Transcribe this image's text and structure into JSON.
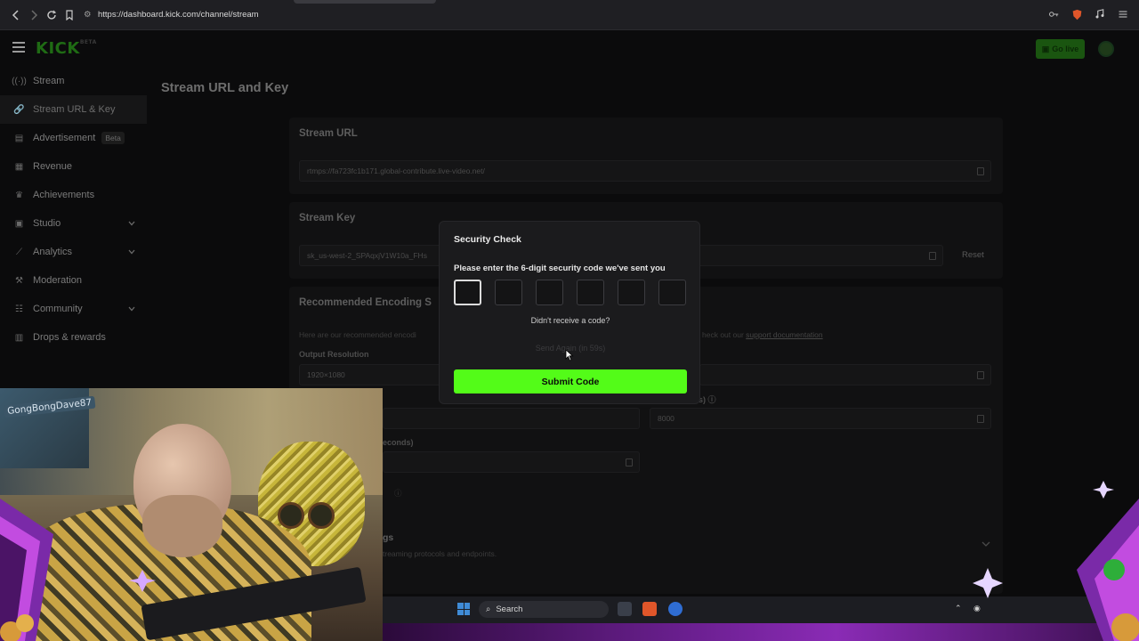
{
  "browser": {
    "url": "https://dashboard.kick.com/channel/stream"
  },
  "header": {
    "logo": "KICK",
    "logo_sup": "BETA",
    "go_live": "Go live"
  },
  "sidebar": {
    "items": [
      {
        "label": "Stream",
        "icon": "broadcast-icon"
      },
      {
        "label": "Stream URL & Key",
        "icon": "link-icon",
        "active": true
      },
      {
        "label": "Advertisement",
        "icon": "ad-icon",
        "badge": "Beta"
      },
      {
        "label": "Revenue",
        "icon": "revenue-icon"
      },
      {
        "label": "Achievements",
        "icon": "trophy-icon"
      },
      {
        "label": "Studio",
        "icon": "studio-icon",
        "expandable": true
      },
      {
        "label": "Analytics",
        "icon": "analytics-icon",
        "expandable": true
      },
      {
        "label": "Moderation",
        "icon": "moderation-icon"
      },
      {
        "label": "Community",
        "icon": "community-icon",
        "expandable": true
      },
      {
        "label": "Drops & rewards",
        "icon": "drops-icon"
      }
    ]
  },
  "main": {
    "title": "Stream URL and Key",
    "stream_url": {
      "title": "Stream URL",
      "value": "rtmps://fa723fc1b171.global-contribute.live-video.net/"
    },
    "stream_key": {
      "title": "Stream Key",
      "value": "sk_us-west-2_SPAqxjV1W10a_FHs",
      "reset": "Reset"
    },
    "encoding": {
      "title": "Recommended Encoding S",
      "desc_left": "Here are our recommended encodi",
      "desc_right": "heck out our",
      "link": "support documentation",
      "output_resolution_label": "Output Resolution",
      "output_resolution_value": "1920×1080",
      "bitrate_label_fragment": "s)",
      "bitrate_value": "8000",
      "keyframe_label_fragment": "econds)",
      "advanced_fragment": "gs",
      "advanced_desc": "treaming protocols and endpoints."
    }
  },
  "modal": {
    "title": "Security Check",
    "description": "Please enter the 6-digit security code we've sent you",
    "code_digits": [
      "",
      "",
      "",
      "",
      "",
      ""
    ],
    "didnt_receive": "Didn't receive a code?",
    "resend": "Send Again (in 59s)",
    "submit": "Submit Code"
  },
  "webcam": {
    "username": "GongBongDave87"
  },
  "taskbar": {
    "search": "Search"
  }
}
